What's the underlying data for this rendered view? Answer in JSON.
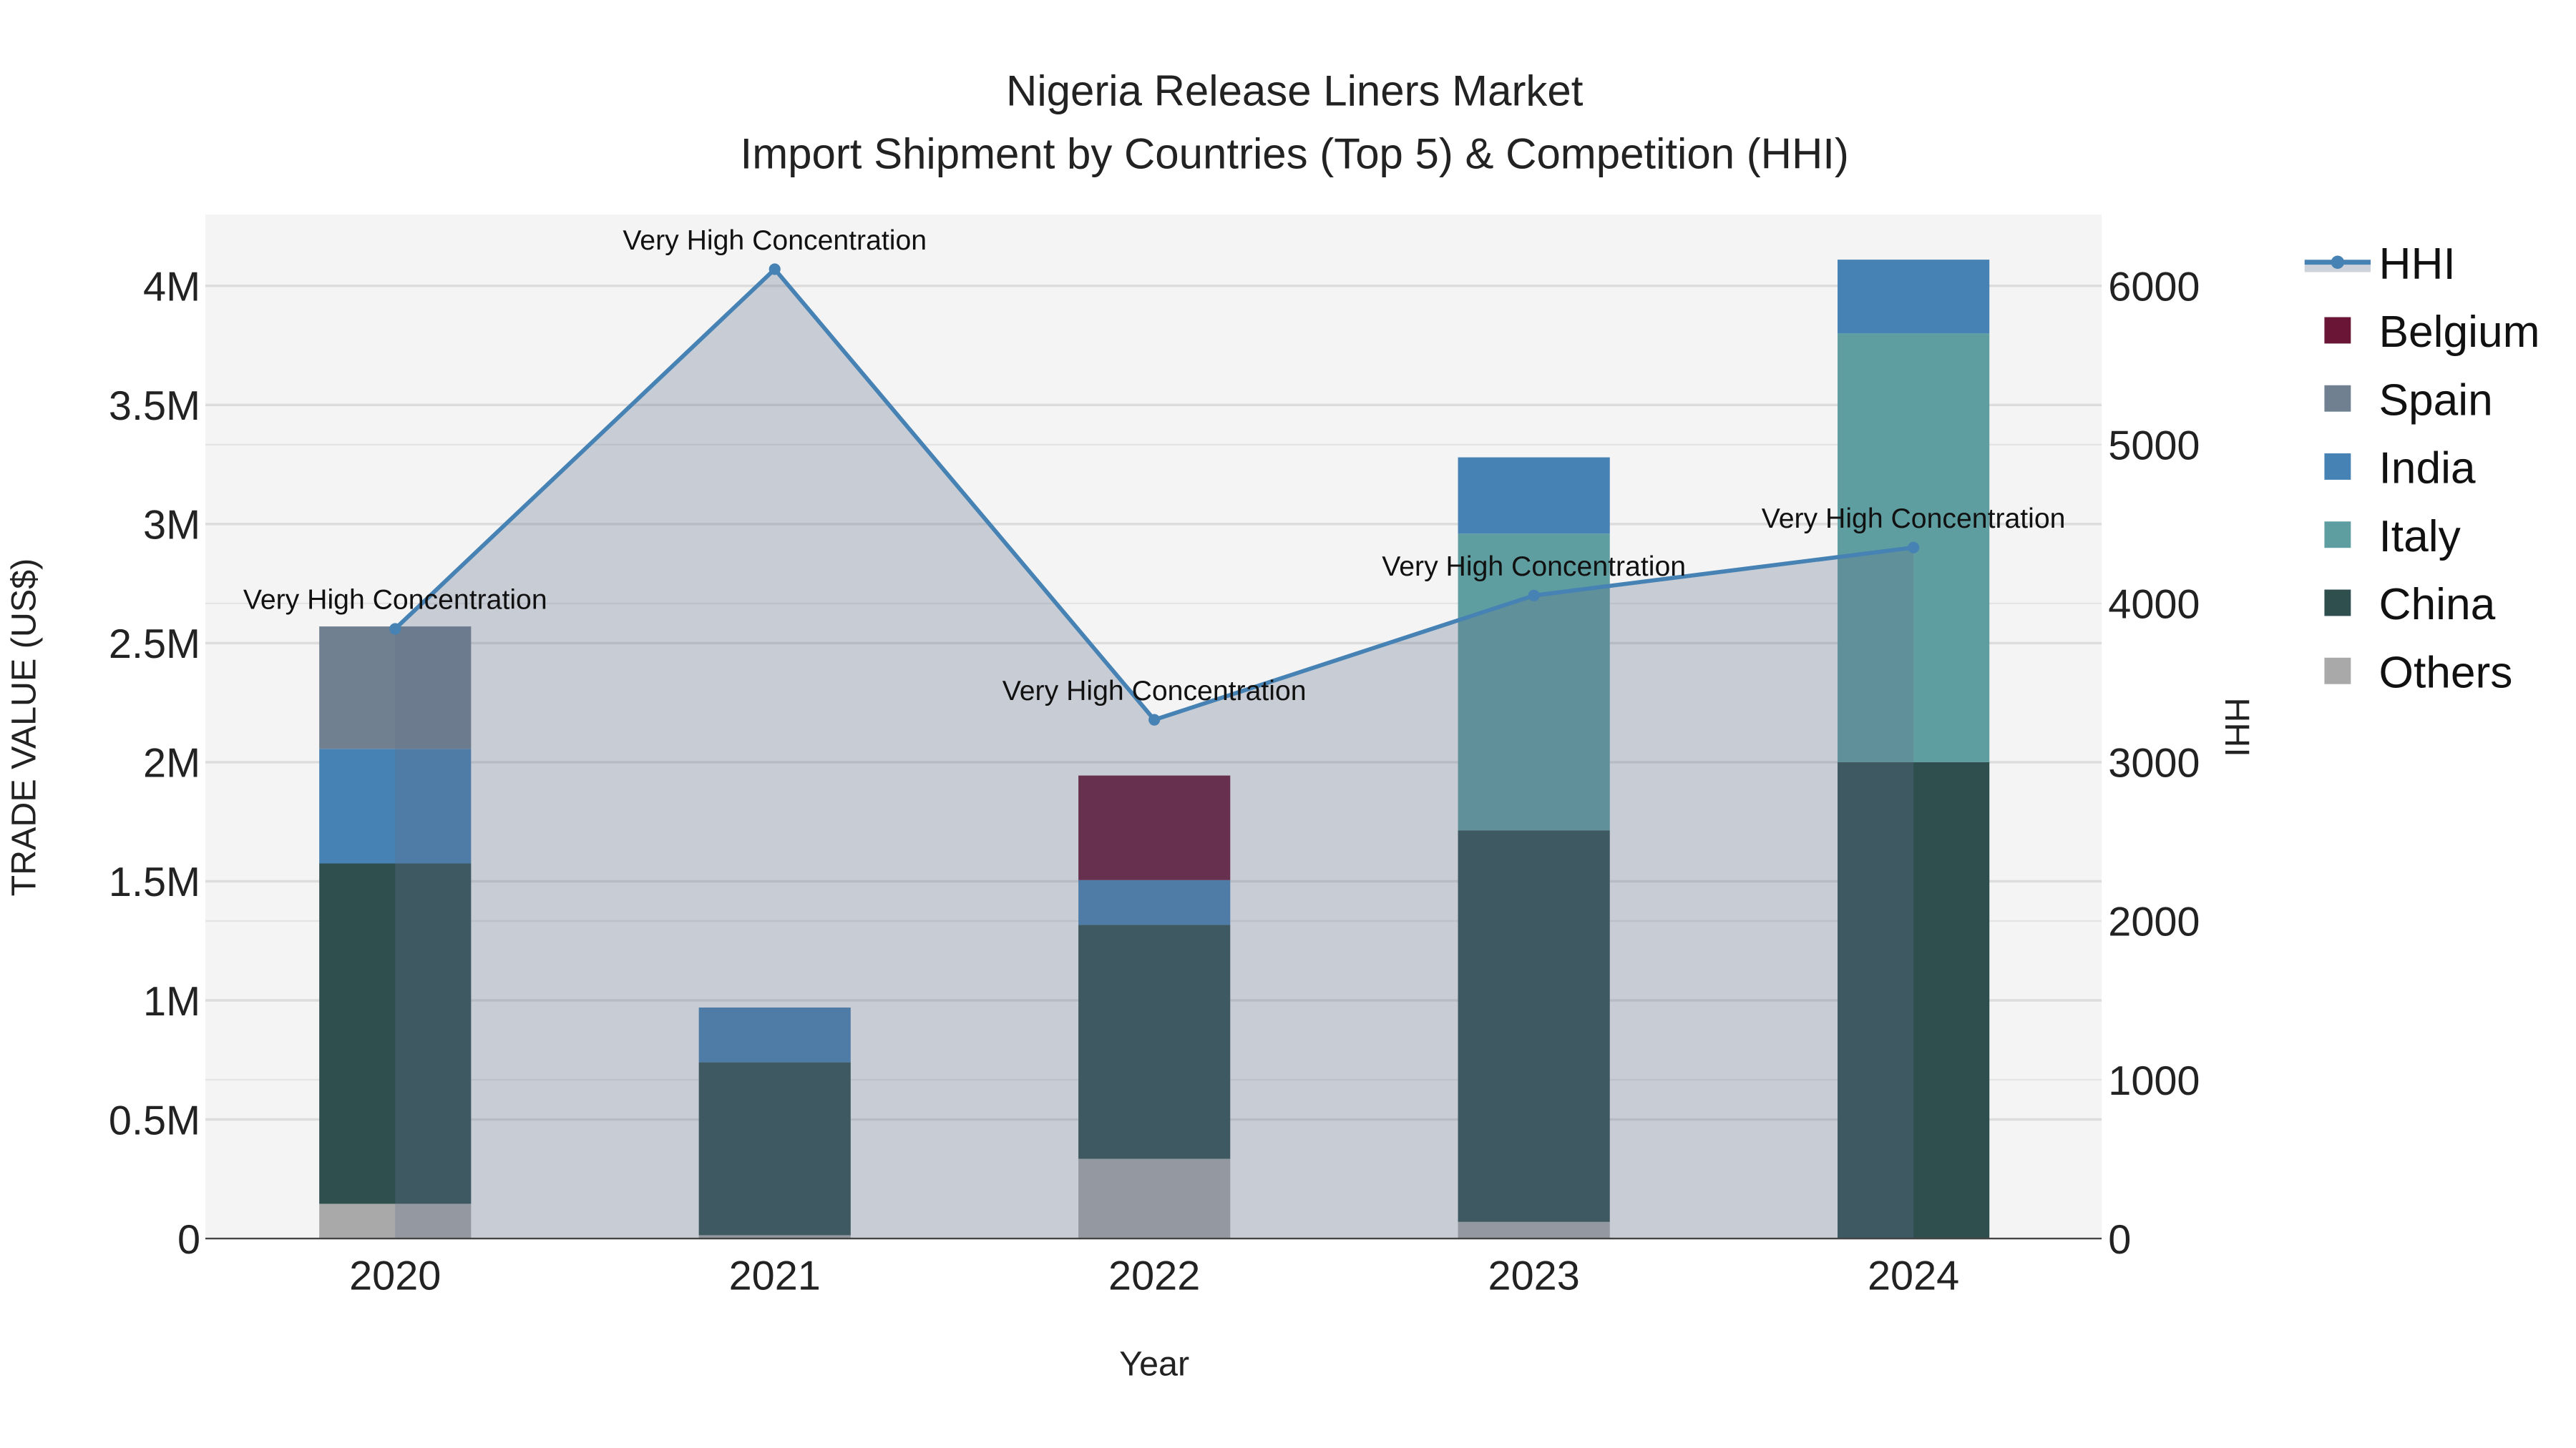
{
  "chart_data": {
    "type": "bar",
    "stacked": true,
    "title": "Nigeria Release Liners Market",
    "subtitle": "Import Shipment by Countries (Top 5) & Competition (HHI)",
    "xlabel": "Year",
    "ylabel": "TRADE VALUE (US$)",
    "y2label": "HHI",
    "categories": [
      "2020",
      "2021",
      "2022",
      "2023",
      "2024"
    ],
    "ylim": [
      0,
      4300000
    ],
    "y2lim": [
      0,
      6450
    ],
    "yticks": [
      0,
      500000,
      1000000,
      1500000,
      2000000,
      2500000,
      3000000,
      3500000,
      4000000
    ],
    "ytick_labels": [
      "0",
      "0.5M",
      "1M",
      "1.5M",
      "2M",
      "2.5M",
      "3M",
      "3.5M",
      "4M"
    ],
    "y2ticks": [
      0,
      1000,
      2000,
      3000,
      4000,
      5000,
      6000
    ],
    "y2tick_labels": [
      "0",
      "1000",
      "2000",
      "3000",
      "4000",
      "5000",
      "6000"
    ],
    "grid": true,
    "legend_position": "right",
    "series": [
      {
        "name": "Others",
        "color": "#A9A9A9",
        "values": [
          146000,
          14000,
          335000,
          70000,
          0
        ]
      },
      {
        "name": "China",
        "color": "#2F4F4F",
        "values": [
          1429000,
          726000,
          982000,
          1644000,
          2000000
        ]
      },
      {
        "name": "Italy",
        "color": "#5F9EA0",
        "values": [
          0,
          0,
          0,
          1246000,
          1800000
        ]
      },
      {
        "name": "India",
        "color": "#4682B4",
        "values": [
          481000,
          230000,
          188000,
          320000,
          310000
        ]
      },
      {
        "name": "Spain",
        "color": "#708090",
        "values": [
          514000,
          0,
          0,
          0,
          0
        ]
      },
      {
        "name": "Belgium",
        "color": "#6B1536",
        "values": [
          0,
          0,
          439000,
          0,
          0
        ]
      }
    ],
    "line": {
      "name": "HHI",
      "color": "#4682B4",
      "values": [
        3840,
        6105,
        3267,
        4050,
        4352
      ],
      "labels": [
        "Very High Concentration",
        "Very High Concentration",
        "Very High Concentration",
        "Very High Concentration",
        "Very High Concentration"
      ]
    },
    "legend_order": [
      "HHI",
      "Belgium",
      "Spain",
      "India",
      "Italy",
      "China",
      "Others"
    ]
  }
}
